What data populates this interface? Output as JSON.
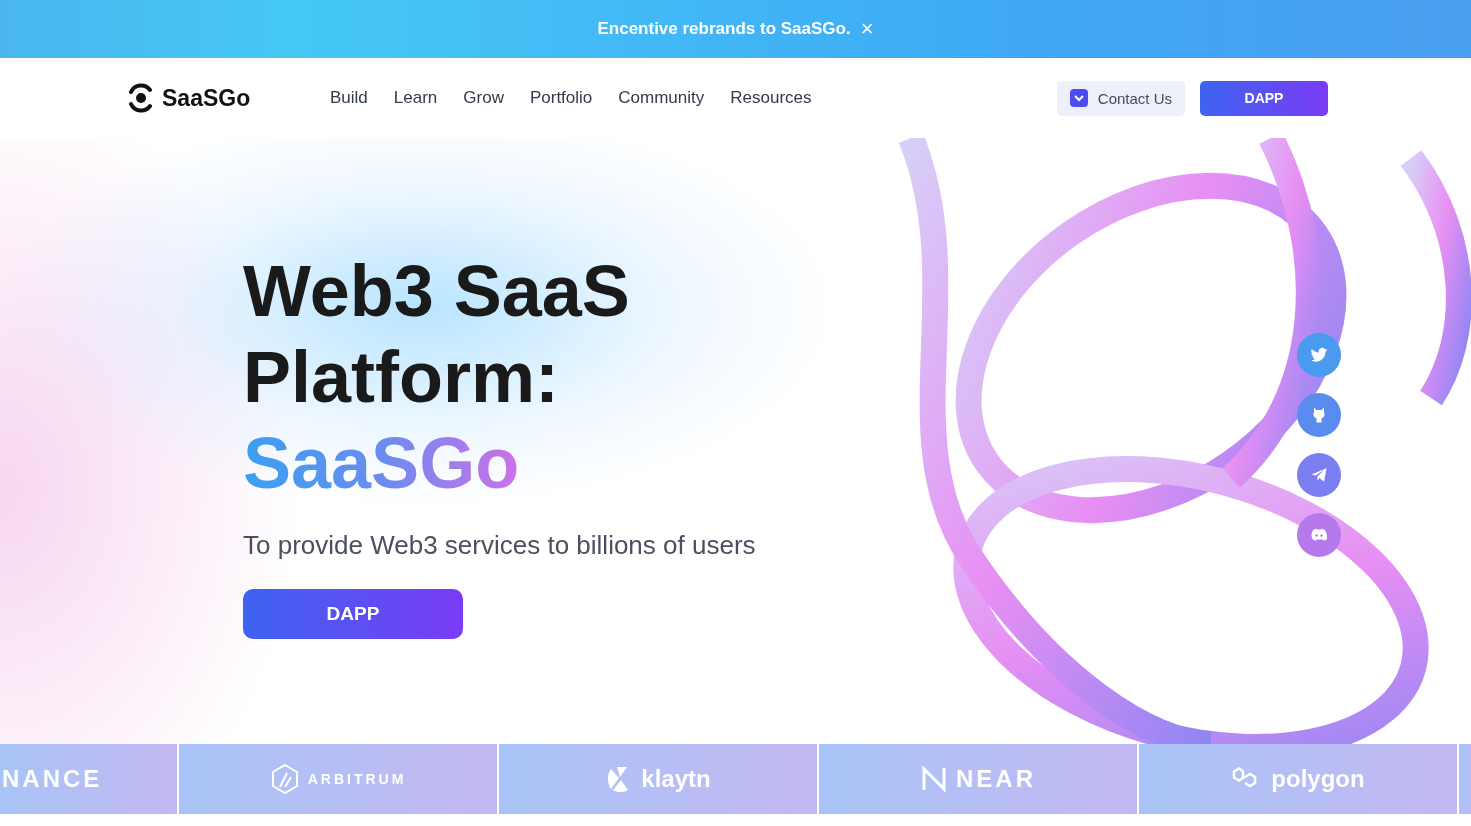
{
  "announcement": {
    "text": "Encentive rebrands to SaaSGo.",
    "close": "×"
  },
  "nav": {
    "logo": "SaaSGo",
    "links": [
      "Build",
      "Learn",
      "Grow",
      "Portfolio",
      "Community",
      "Resources"
    ],
    "contact": "Contact Us",
    "dapp": "DAPP"
  },
  "hero": {
    "title_lines": [
      "Web3 SaaS",
      "Platform:"
    ],
    "brand": "SaaSGo",
    "subtitle": "To provide Web3 services to billions of users",
    "button": "DAPP"
  },
  "socials": [
    {
      "kind": "twitter",
      "color": "#4a9af0"
    },
    {
      "kind": "github",
      "color": "#5a8cf0"
    },
    {
      "kind": "telegram",
      "color": "#7a7ef0"
    },
    {
      "kind": "discord",
      "color": "#b679ec"
    }
  ],
  "partners": [
    {
      "kind": "text",
      "name": "NANCE"
    },
    {
      "kind": "arbitrum",
      "name": "ARBITRUM"
    },
    {
      "kind": "klaytn",
      "name": "klaytn"
    },
    {
      "kind": "near",
      "name": "NEAR"
    },
    {
      "kind": "polygon",
      "name": "polygon"
    },
    {
      "kind": "blank"
    }
  ]
}
